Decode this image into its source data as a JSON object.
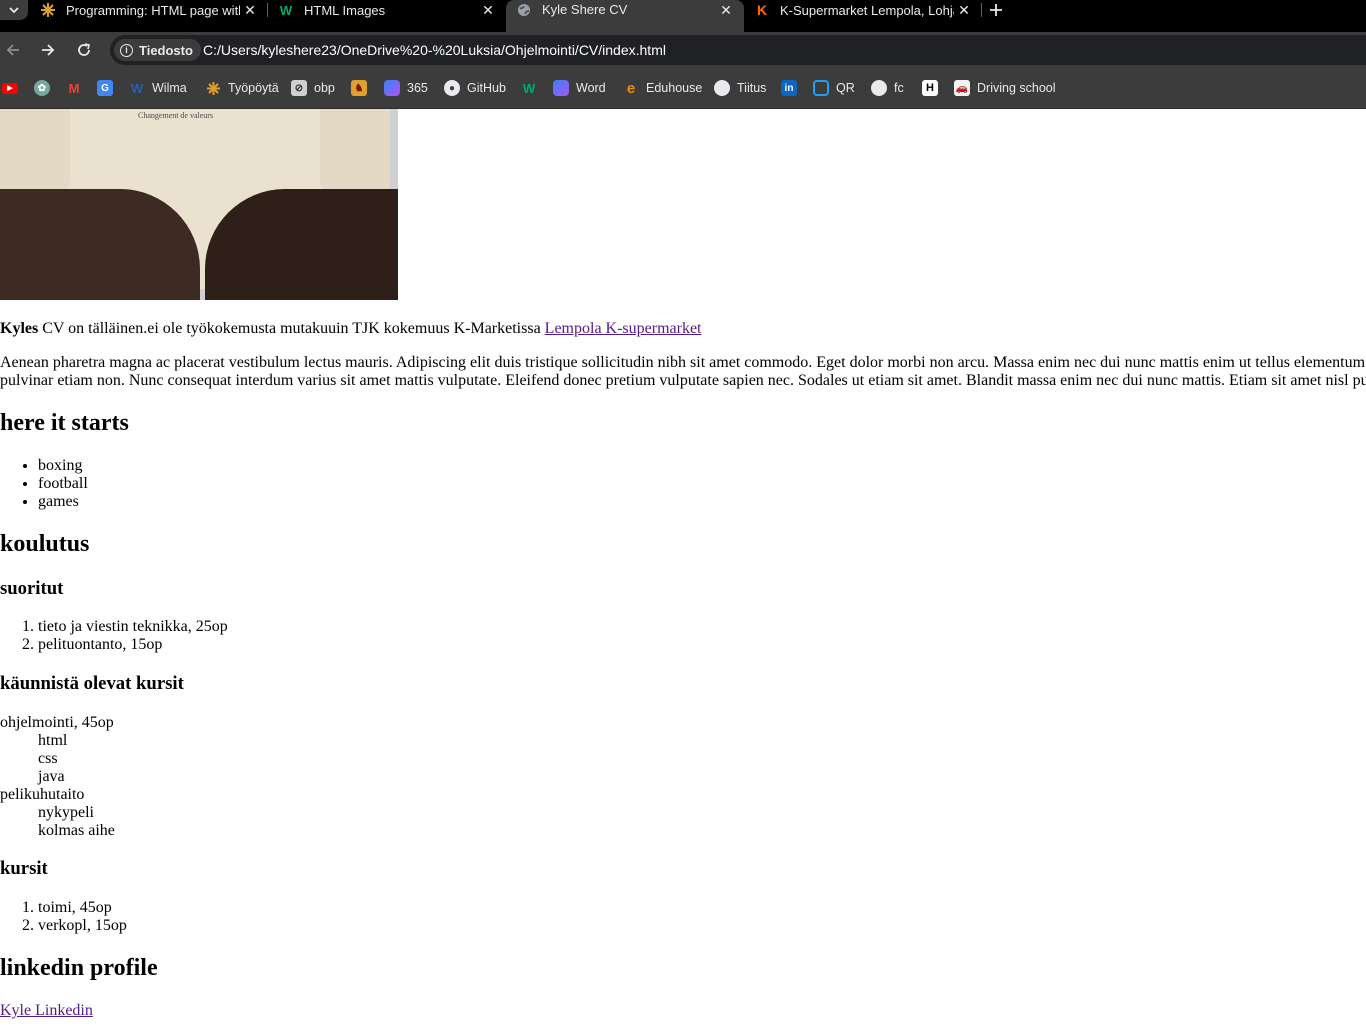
{
  "tabs": [
    {
      "title": "Programming: HTML page with",
      "close": "✕",
      "favicon": "sunburst-icon",
      "active": false
    },
    {
      "title": "HTML Images",
      "close": "✕",
      "favicon": "w3schools-icon",
      "active": false
    },
    {
      "title": "Kyle Shere CV",
      "close": "✕",
      "favicon": "globe-icon",
      "active": true
    },
    {
      "title": "K-Supermarket Lempola, Lohja",
      "close": "✕",
      "favicon": "k-logo-icon",
      "active": false
    }
  ],
  "toolbar": {
    "security_chip": "Tiedosto",
    "url": "C:/Users/kyleshere23/OneDrive%20-%20Luksia/Ohjelmointi/CV/index.html"
  },
  "bookmarks": [
    {
      "label": "",
      "icon": "youtube-icon"
    },
    {
      "label": "",
      "icon": "chatgpt-icon"
    },
    {
      "label": "",
      "icon": "gmail-icon"
    },
    {
      "label": "",
      "icon": "translate-icon"
    },
    {
      "label": "Wilma",
      "icon": "wilma-icon"
    },
    {
      "label": "Työpöytä",
      "icon": "sunburst-icon"
    },
    {
      "label": "obp",
      "icon": "obp-icon"
    },
    {
      "label": "",
      "icon": "game-icon"
    },
    {
      "label": "365",
      "icon": "copilot-icon"
    },
    {
      "label": "GitHub",
      "icon": "github-icon"
    },
    {
      "label": "",
      "icon": "w3schools-icon"
    },
    {
      "label": "Word",
      "icon": "copilot-icon"
    },
    {
      "label": "Eduhouse",
      "icon": "eduhouse-icon"
    },
    {
      "label": "Tiitus",
      "icon": "globe-icon"
    },
    {
      "label": "",
      "icon": "linkedin-icon"
    },
    {
      "label": "QR",
      "icon": "qr-icon"
    },
    {
      "label": "fc",
      "icon": "globe-icon"
    },
    {
      "label": "",
      "icon": "h-logo-icon"
    },
    {
      "label": "Driving school",
      "icon": "driving-icon"
    }
  ],
  "page": {
    "shirt_print": "Changement de valeurs",
    "intro_bold": "Kyles",
    "intro_text": " CV on tälläinen.ei ole työkokemusta mutakuuin TJK kokemuus K-Marketissa ",
    "intro_link": "Lempola K-supermarket",
    "lorem_line1": "Aenean pharetra magna ac placerat vestibulum lectus mauris. Adipiscing elit duis tristique sollicitudin nibh sit amet commodo. Eget dolor morbi non arcu. Massa enim nec dui nunc mattis enim ut tellus elementum.",
    "lorem_line2": "pulvinar etiam non. Nunc consequat interdum varius sit amet mattis vulputate. Eleifend donec pretium vulputate sapien nec. Sodales ut etiam sit amet. Blandit massa enim nec dui nunc mattis. Etiam sit amet nisl pu",
    "heading_starts": "here it starts",
    "hobbies": [
      "boxing",
      "football",
      "games"
    ],
    "heading_koulutus": "koulutus",
    "heading_suoritut": "suoritut",
    "suoritut": [
      "tieto ja viestin teknikka, 25op",
      "pelituontanto, 15op"
    ],
    "heading_kaynnista": "käunnistä olevat kursit",
    "ongoing": [
      {
        "term": "ohjelmointi, 45op",
        "items": [
          "html",
          "css",
          "java"
        ]
      },
      {
        "term": "pelikuhutaito",
        "items": [
          "nykypeli",
          "kolmas aihe"
        ]
      }
    ],
    "heading_kursit": "kursit",
    "kursit": [
      "toimi, 45op",
      "verkopl, 15op"
    ],
    "heading_linkedin": "linkedin profile",
    "linkedin_link": "Kyle Linkedin"
  },
  "colors": {
    "visited_link": "#551a8b",
    "chrome_dark": "#3c3c3c",
    "tabbar": "#000000"
  }
}
